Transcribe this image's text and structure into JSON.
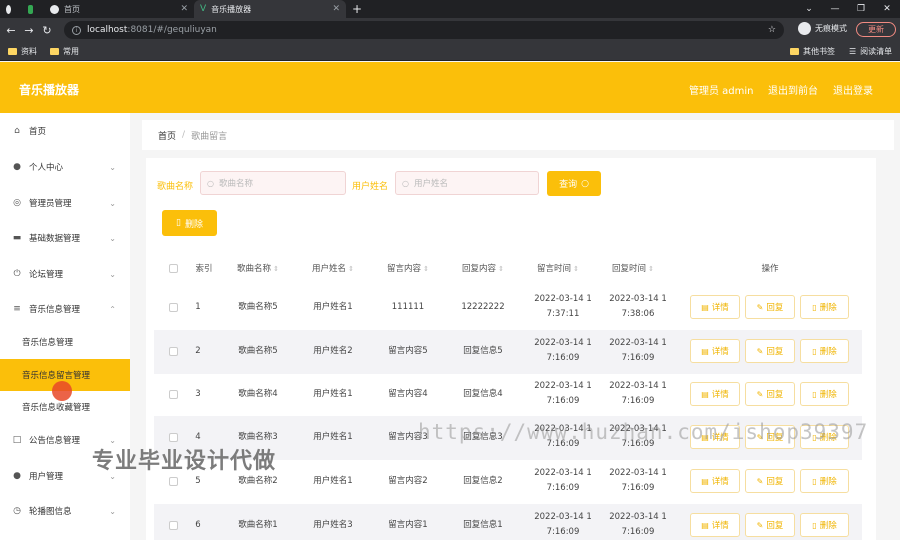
{
  "browser": {
    "tabs": [
      {
        "title": ""
      },
      {
        "title": ""
      },
      {
        "title": "首页"
      },
      {
        "title": "音乐播放器"
      }
    ],
    "url_host": "localhost",
    "url_path": ":8081/#/gequliuyan",
    "incognito_label": "无痕模式",
    "update_label": "更新",
    "bookmarks": [
      "资料",
      "常用"
    ],
    "other_bookmarks": "其他书签",
    "reading_list": "阅读清单"
  },
  "header": {
    "title": "音乐播放器",
    "admin": "管理员 admin",
    "back_to_home": "退出到前台",
    "logout": "退出登录"
  },
  "sidebar": {
    "items": [
      {
        "label": "首页",
        "icon": "home-icon"
      },
      {
        "label": "个人中心",
        "icon": "user-icon"
      },
      {
        "label": "管理员管理",
        "icon": "compass-icon"
      },
      {
        "label": "基础数据管理",
        "icon": "printer-icon"
      },
      {
        "label": "论坛管理",
        "icon": "power-icon"
      },
      {
        "label": "音乐信息管理",
        "icon": "menu-icon"
      },
      {
        "label": "公告信息管理",
        "icon": "box-icon"
      },
      {
        "label": "用户管理",
        "icon": "user-icon"
      },
      {
        "label": "轮播图信息",
        "icon": "clock-icon"
      }
    ],
    "sub_items": [
      {
        "label": "音乐信息管理"
      },
      {
        "label": "音乐信息留言管理"
      },
      {
        "label": "音乐信息收藏管理"
      }
    ]
  },
  "breadcrumb": {
    "home": "首页",
    "current": "歌曲留言"
  },
  "search": {
    "song_label": "歌曲名称",
    "song_placeholder": "歌曲名称",
    "user_label": "用户姓名",
    "user_placeholder": "用户姓名",
    "query_button": "查询"
  },
  "toolbar": {
    "delete_button": "删除"
  },
  "table": {
    "headers": [
      "索引",
      "歌曲名称",
      "用户姓名",
      "留言内容",
      "回复内容",
      "留言时间",
      "回复时间",
      "操作"
    ],
    "actions": {
      "detail": "详情",
      "reply": "回复",
      "delete": "删除"
    },
    "rows": [
      {
        "index": "1",
        "song": "歌曲名称5",
        "user": "用户姓名1",
        "message": "111111",
        "reply": "12222222",
        "msg_time_1": "2022-03-14 1",
        "msg_time_2": "7:37:11",
        "reply_time_1": "2022-03-14 1",
        "reply_time_2": "7:38:06"
      },
      {
        "index": "2",
        "song": "歌曲名称5",
        "user": "用户姓名2",
        "message": "留言内容5",
        "reply": "回复信息5",
        "msg_time_1": "2022-03-14 1",
        "msg_time_2": "7:16:09",
        "reply_time_1": "2022-03-14 1",
        "reply_time_2": "7:16:09"
      },
      {
        "index": "3",
        "song": "歌曲名称4",
        "user": "用户姓名1",
        "message": "留言内容4",
        "reply": "回复信息4",
        "msg_time_1": "2022-03-14 1",
        "msg_time_2": "7:16:09",
        "reply_time_1": "2022-03-14 1",
        "reply_time_2": "7:16:09"
      },
      {
        "index": "4",
        "song": "歌曲名称3",
        "user": "用户姓名1",
        "message": "留言内容3",
        "reply": "回复信息3",
        "msg_time_1": "2022-03-14 1",
        "msg_time_2": "7:16:09",
        "reply_time_1": "2022-03-14 1",
        "reply_time_2": "7:16:09"
      },
      {
        "index": "5",
        "song": "歌曲名称2",
        "user": "用户姓名1",
        "message": "留言内容2",
        "reply": "回复信息2",
        "msg_time_1": "2022-03-14 1",
        "msg_time_2": "7:16:09",
        "reply_time_1": "2022-03-14 1",
        "reply_time_2": "7:16:09"
      },
      {
        "index": "6",
        "song": "歌曲名称1",
        "user": "用户姓名3",
        "message": "留言内容1",
        "reply": "回复信息1",
        "msg_time_1": "2022-03-14 1",
        "msg_time_2": "7:16:09",
        "reply_time_1": "2022-03-14 1",
        "reply_time_2": "7:16:09"
      }
    ]
  },
  "watermarks": {
    "url": "https://www.huzhan.com/ishop39397",
    "text": "专业毕业设计代做"
  },
  "colors": {
    "accent": "#fbbf0a",
    "cursor": "#e84828"
  }
}
